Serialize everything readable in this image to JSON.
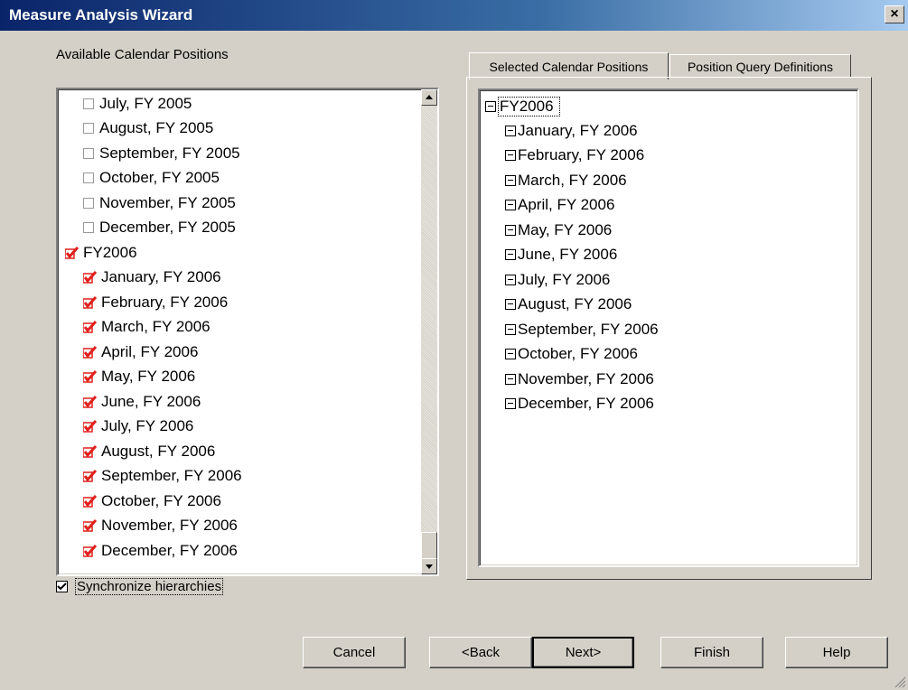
{
  "window": {
    "title": "Measure Analysis Wizard",
    "close_glyph": "×"
  },
  "available": {
    "label": "Available Calendar Positions",
    "items": [
      {
        "label": "July, FY 2005",
        "checked": false,
        "level": 1
      },
      {
        "label": "August, FY 2005",
        "checked": false,
        "level": 1
      },
      {
        "label": "September, FY 2005",
        "checked": false,
        "level": 1
      },
      {
        "label": "October, FY 2005",
        "checked": false,
        "level": 1
      },
      {
        "label": "November, FY 2005",
        "checked": false,
        "level": 1
      },
      {
        "label": "December, FY 2005",
        "checked": false,
        "level": 1
      },
      {
        "label": "FY2006",
        "checked": true,
        "level": 0
      },
      {
        "label": "January, FY 2006",
        "checked": true,
        "level": 1
      },
      {
        "label": "February, FY 2006",
        "checked": true,
        "level": 1
      },
      {
        "label": "March, FY 2006",
        "checked": true,
        "level": 1
      },
      {
        "label": "April, FY 2006",
        "checked": true,
        "level": 1
      },
      {
        "label": "May, FY 2006",
        "checked": true,
        "level": 1
      },
      {
        "label": "June, FY 2006",
        "checked": true,
        "level": 1
      },
      {
        "label": "July, FY 2006",
        "checked": true,
        "level": 1
      },
      {
        "label": "August, FY 2006",
        "checked": true,
        "level": 1
      },
      {
        "label": "September, FY 2006",
        "checked": true,
        "level": 1
      },
      {
        "label": "October, FY 2006",
        "checked": true,
        "level": 1
      },
      {
        "label": "November, FY 2006",
        "checked": true,
        "level": 1
      },
      {
        "label": "December, FY 2006",
        "checked": true,
        "level": 1
      }
    ]
  },
  "tabs": [
    {
      "label": "Selected Calendar Positions",
      "active": true
    },
    {
      "label": "Position Query Definitions",
      "active": false
    }
  ],
  "selected": {
    "root": "FY2006",
    "items": [
      "January, FY 2006",
      "February, FY 2006",
      "March, FY 2006",
      "April, FY 2006",
      "May, FY 2006",
      "June, FY 2006",
      "July, FY 2006",
      "August, FY 2006",
      "September, FY 2006",
      "October, FY 2006",
      "November, FY 2006",
      "December, FY 2006"
    ]
  },
  "sync": {
    "label": "Synchronize hierarchies",
    "checked": true
  },
  "buttons": {
    "cancel": "Cancel",
    "back": "<Back",
    "next": "Next>",
    "finish": "Finish",
    "help": "Help"
  },
  "colors": {
    "check_mark": "#e0201c",
    "titlebar": "#0a246a",
    "face": "#d4d0c8"
  }
}
